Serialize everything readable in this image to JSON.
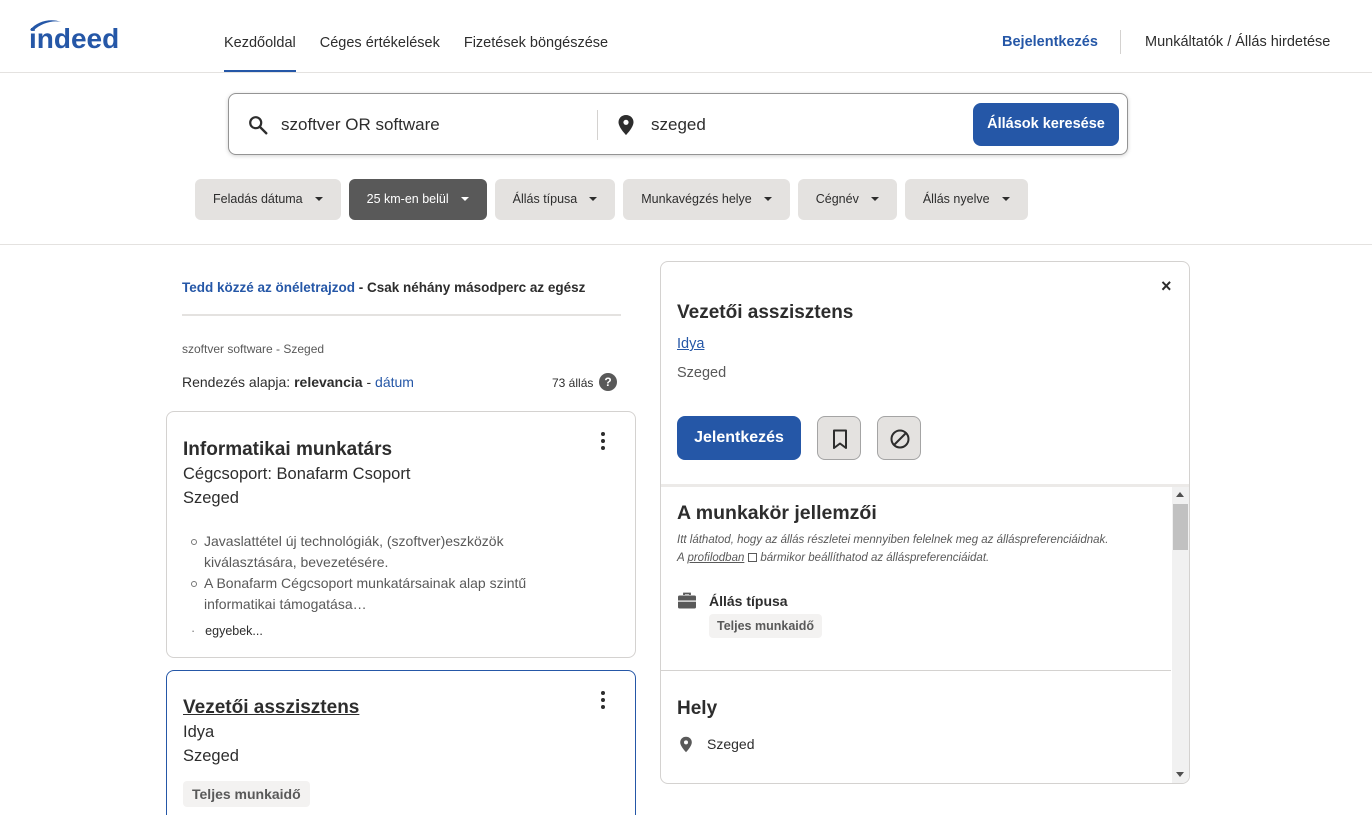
{
  "header": {
    "logo": "indeed",
    "nav": [
      "Kezdőoldal",
      "Céges értékelések",
      "Fizetések böngészése"
    ],
    "signin": "Bejelentkezés",
    "employers": "Munkáltatók / Állás hirdetése"
  },
  "search": {
    "what_value": "szoftver OR software",
    "where_value": "szeged",
    "button": "Állások keresése"
  },
  "filters": [
    "Feladás dátuma",
    "25 km-en belül",
    "Állás típusa",
    "Munkavégzés helye",
    "Cégnév",
    "Állás nyelve"
  ],
  "results": {
    "promo_link": "Tedd közzé az önéletrajzod",
    "promo_text": " - Csak néhány másodperc az egész",
    "query": "szoftver software - Szeged",
    "sort_label": "Rendezés alapja:",
    "sort_active": "relevancia",
    "sort_sep": " - ",
    "sort_other": "dátum",
    "count": "73 állás",
    "help": "?"
  },
  "jobs": [
    {
      "title": "Informatikai munkatárs",
      "company": "Cégcsoport: Bonafarm Csoport",
      "location": "Szeged",
      "snippets": [
        "Javaslattétel új technológiák, (szoftver)eszközök kiválasztására, bevezetésére.",
        "A Bonafarm Cégcsoport munkatársainak alap szintű informatikai támogatása…"
      ],
      "more": "egyebek..."
    },
    {
      "title": "Vezetői asszisztens",
      "company": "Idya",
      "location": "Szeged",
      "tag": "Teljes munkaidő"
    }
  ],
  "detail": {
    "close": "×",
    "title": "Vezetői asszisztens",
    "company": "Idya",
    "location": "Szeged",
    "apply": "Jelentkezés",
    "section_title": "A munkakör jellemzői",
    "note_1": "Itt láthatod, hogy az állás részletei mennyiben felelnek meg az álláspreferenciáidnak.",
    "note_2a": "A",
    "note_2_link": "profilodban",
    "note_2b": "bármikor beállíthatod az álláspreferenciáidat.",
    "job_type_label": "Állás típusa",
    "job_type_value": "Teljes munkaidő",
    "location_title": "Hely",
    "location_value": "Szeged"
  },
  "colors": {
    "brand": "#2557a7",
    "text": "#2d2d2d",
    "muted": "#595959"
  },
  "icons": [
    "search-icon",
    "location-pin-icon",
    "bookmark-icon",
    "not-interested-icon",
    "briefcase-icon",
    "kebab-menu-icon",
    "close-icon",
    "external-link-icon",
    "help-icon"
  ]
}
